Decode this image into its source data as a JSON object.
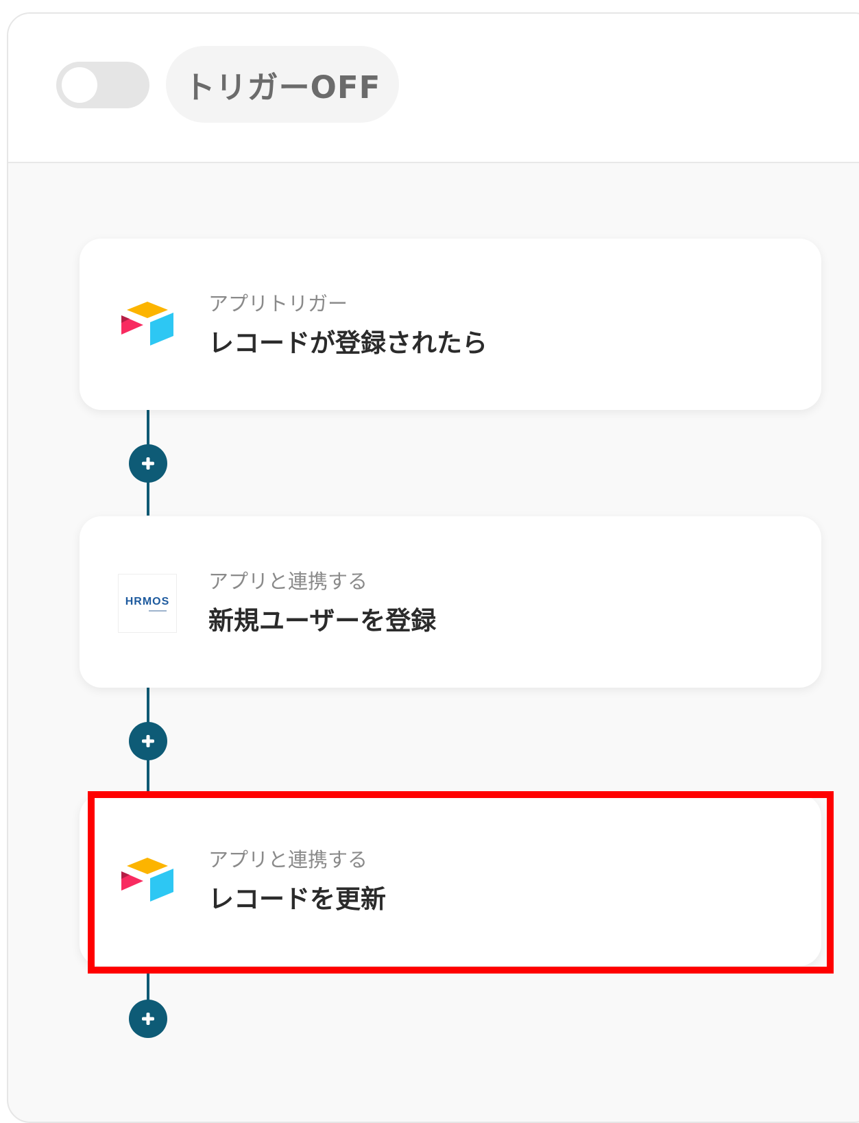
{
  "header": {
    "trigger_status": "トリガーOFF",
    "toggle_on": false
  },
  "flow": {
    "steps": [
      {
        "icon": "airtable-logo-icon",
        "subtitle": "アプリトリガー",
        "title": "レコードが登録されたら"
      },
      {
        "icon": "hrmos-logo-icon",
        "logo_text": "HRMOS",
        "subtitle": "アプリと連携する",
        "title": "新規ユーザーを登録"
      },
      {
        "icon": "airtable-logo-icon",
        "subtitle": "アプリと連携する",
        "title": "レコードを更新",
        "highlighted": true
      }
    ]
  },
  "colors": {
    "accent": "#0e5b76",
    "highlight": "#ff0000",
    "toggle_off": "#e5e5e5"
  }
}
